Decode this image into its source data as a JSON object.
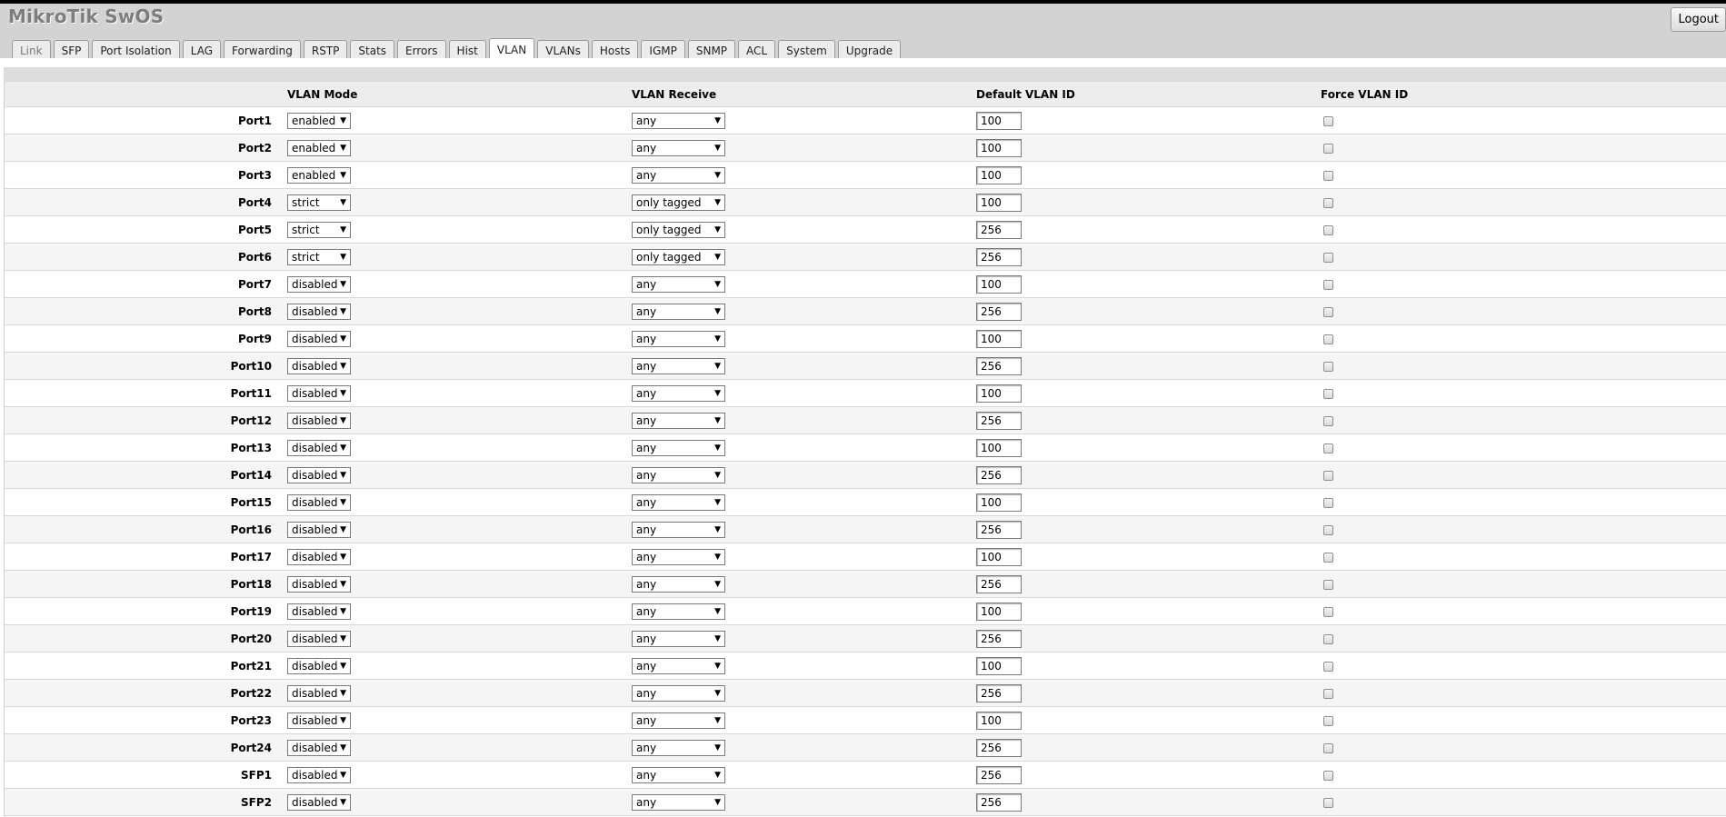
{
  "app": {
    "brand": "MikroTik SwOS",
    "logout_label": "Logout"
  },
  "tabs": [
    {
      "label": "Link",
      "active": false
    },
    {
      "label": "SFP",
      "active": false
    },
    {
      "label": "Port Isolation",
      "active": false
    },
    {
      "label": "LAG",
      "active": false
    },
    {
      "label": "Forwarding",
      "active": false
    },
    {
      "label": "RSTP",
      "active": false
    },
    {
      "label": "Stats",
      "active": false
    },
    {
      "label": "Errors",
      "active": false
    },
    {
      "label": "Hist",
      "active": false
    },
    {
      "label": "VLAN",
      "active": true
    },
    {
      "label": "VLANs",
      "active": false
    },
    {
      "label": "Hosts",
      "active": false
    },
    {
      "label": "IGMP",
      "active": false
    },
    {
      "label": "SNMP",
      "active": false
    },
    {
      "label": "ACL",
      "active": false
    },
    {
      "label": "System",
      "active": false
    },
    {
      "label": "Upgrade",
      "active": false
    }
  ],
  "table": {
    "headers": {
      "vlan_mode": "VLAN Mode",
      "vlan_receive": "VLAN Receive",
      "default_vlan_id": "Default VLAN ID",
      "force_vlan_id": "Force VLAN ID"
    },
    "rows": [
      {
        "port": "Port1",
        "mode": "enabled",
        "receive": "any",
        "vlan_id": "100",
        "force": false
      },
      {
        "port": "Port2",
        "mode": "enabled",
        "receive": "any",
        "vlan_id": "100",
        "force": false
      },
      {
        "port": "Port3",
        "mode": "enabled",
        "receive": "any",
        "vlan_id": "100",
        "force": false
      },
      {
        "port": "Port4",
        "mode": "strict",
        "receive": "only tagged",
        "vlan_id": "100",
        "force": false
      },
      {
        "port": "Port5",
        "mode": "strict",
        "receive": "only tagged",
        "vlan_id": "256",
        "force": false
      },
      {
        "port": "Port6",
        "mode": "strict",
        "receive": "only tagged",
        "vlan_id": "256",
        "force": false
      },
      {
        "port": "Port7",
        "mode": "disabled",
        "receive": "any",
        "vlan_id": "100",
        "force": false
      },
      {
        "port": "Port8",
        "mode": "disabled",
        "receive": "any",
        "vlan_id": "256",
        "force": false
      },
      {
        "port": "Port9",
        "mode": "disabled",
        "receive": "any",
        "vlan_id": "100",
        "force": false
      },
      {
        "port": "Port10",
        "mode": "disabled",
        "receive": "any",
        "vlan_id": "256",
        "force": false
      },
      {
        "port": "Port11",
        "mode": "disabled",
        "receive": "any",
        "vlan_id": "100",
        "force": false
      },
      {
        "port": "Port12",
        "mode": "disabled",
        "receive": "any",
        "vlan_id": "256",
        "force": false
      },
      {
        "port": "Port13",
        "mode": "disabled",
        "receive": "any",
        "vlan_id": "100",
        "force": false
      },
      {
        "port": "Port14",
        "mode": "disabled",
        "receive": "any",
        "vlan_id": "256",
        "force": false
      },
      {
        "port": "Port15",
        "mode": "disabled",
        "receive": "any",
        "vlan_id": "100",
        "force": false
      },
      {
        "port": "Port16",
        "mode": "disabled",
        "receive": "any",
        "vlan_id": "256",
        "force": false
      },
      {
        "port": "Port17",
        "mode": "disabled",
        "receive": "any",
        "vlan_id": "100",
        "force": false
      },
      {
        "port": "Port18",
        "mode": "disabled",
        "receive": "any",
        "vlan_id": "256",
        "force": false
      },
      {
        "port": "Port19",
        "mode": "disabled",
        "receive": "any",
        "vlan_id": "100",
        "force": false
      },
      {
        "port": "Port20",
        "mode": "disabled",
        "receive": "any",
        "vlan_id": "256",
        "force": false
      },
      {
        "port": "Port21",
        "mode": "disabled",
        "receive": "any",
        "vlan_id": "100",
        "force": false
      },
      {
        "port": "Port22",
        "mode": "disabled",
        "receive": "any",
        "vlan_id": "256",
        "force": false
      },
      {
        "port": "Port23",
        "mode": "disabled",
        "receive": "any",
        "vlan_id": "100",
        "force": false
      },
      {
        "port": "Port24",
        "mode": "disabled",
        "receive": "any",
        "vlan_id": "256",
        "force": false
      },
      {
        "port": "SFP1",
        "mode": "disabled",
        "receive": "any",
        "vlan_id": "256",
        "force": false
      },
      {
        "port": "SFP2",
        "mode": "disabled",
        "receive": "any",
        "vlan_id": "256",
        "force": false
      }
    ]
  },
  "colors": {
    "header_bg": "#d3d3d3",
    "brand_text": "#7d7d7d",
    "row_alt": "#f5f5f5"
  }
}
